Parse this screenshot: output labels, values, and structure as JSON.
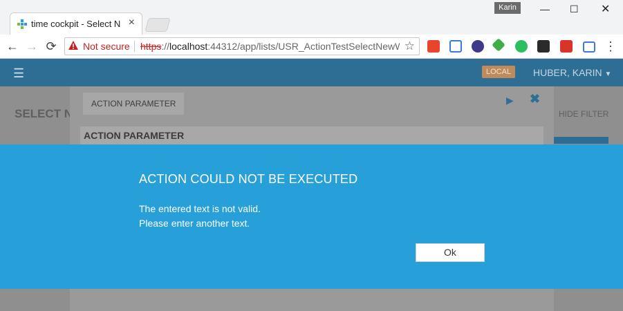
{
  "browser": {
    "tab_title": "time cockpit - Select Nev",
    "profile_name": "Karin",
    "omnibox": {
      "security_label": "Not secure",
      "url_scheme": "https",
      "url_sep": "://",
      "url_host": "localhost",
      "url_rest": ":44312/app/lists/USR_ActionTestSelectNewW"
    }
  },
  "app": {
    "environment_badge": "LOCAL",
    "user_name": "HUBER, KARIN",
    "page_title": "SELECT NE",
    "hide_filter": "HIDE FILTER"
  },
  "dialog": {
    "tab_label": "ACTION PARAMETER",
    "section_label": "ACTION PARAMETER"
  },
  "error_modal": {
    "title": "ACTION COULD NOT BE EXECUTED",
    "line1": "The entered text is not valid.",
    "line2": "Please enter another text.",
    "ok_label": "Ok"
  },
  "colors": {
    "modal_background": "#279fd9",
    "app_header": "#2f6e94"
  }
}
